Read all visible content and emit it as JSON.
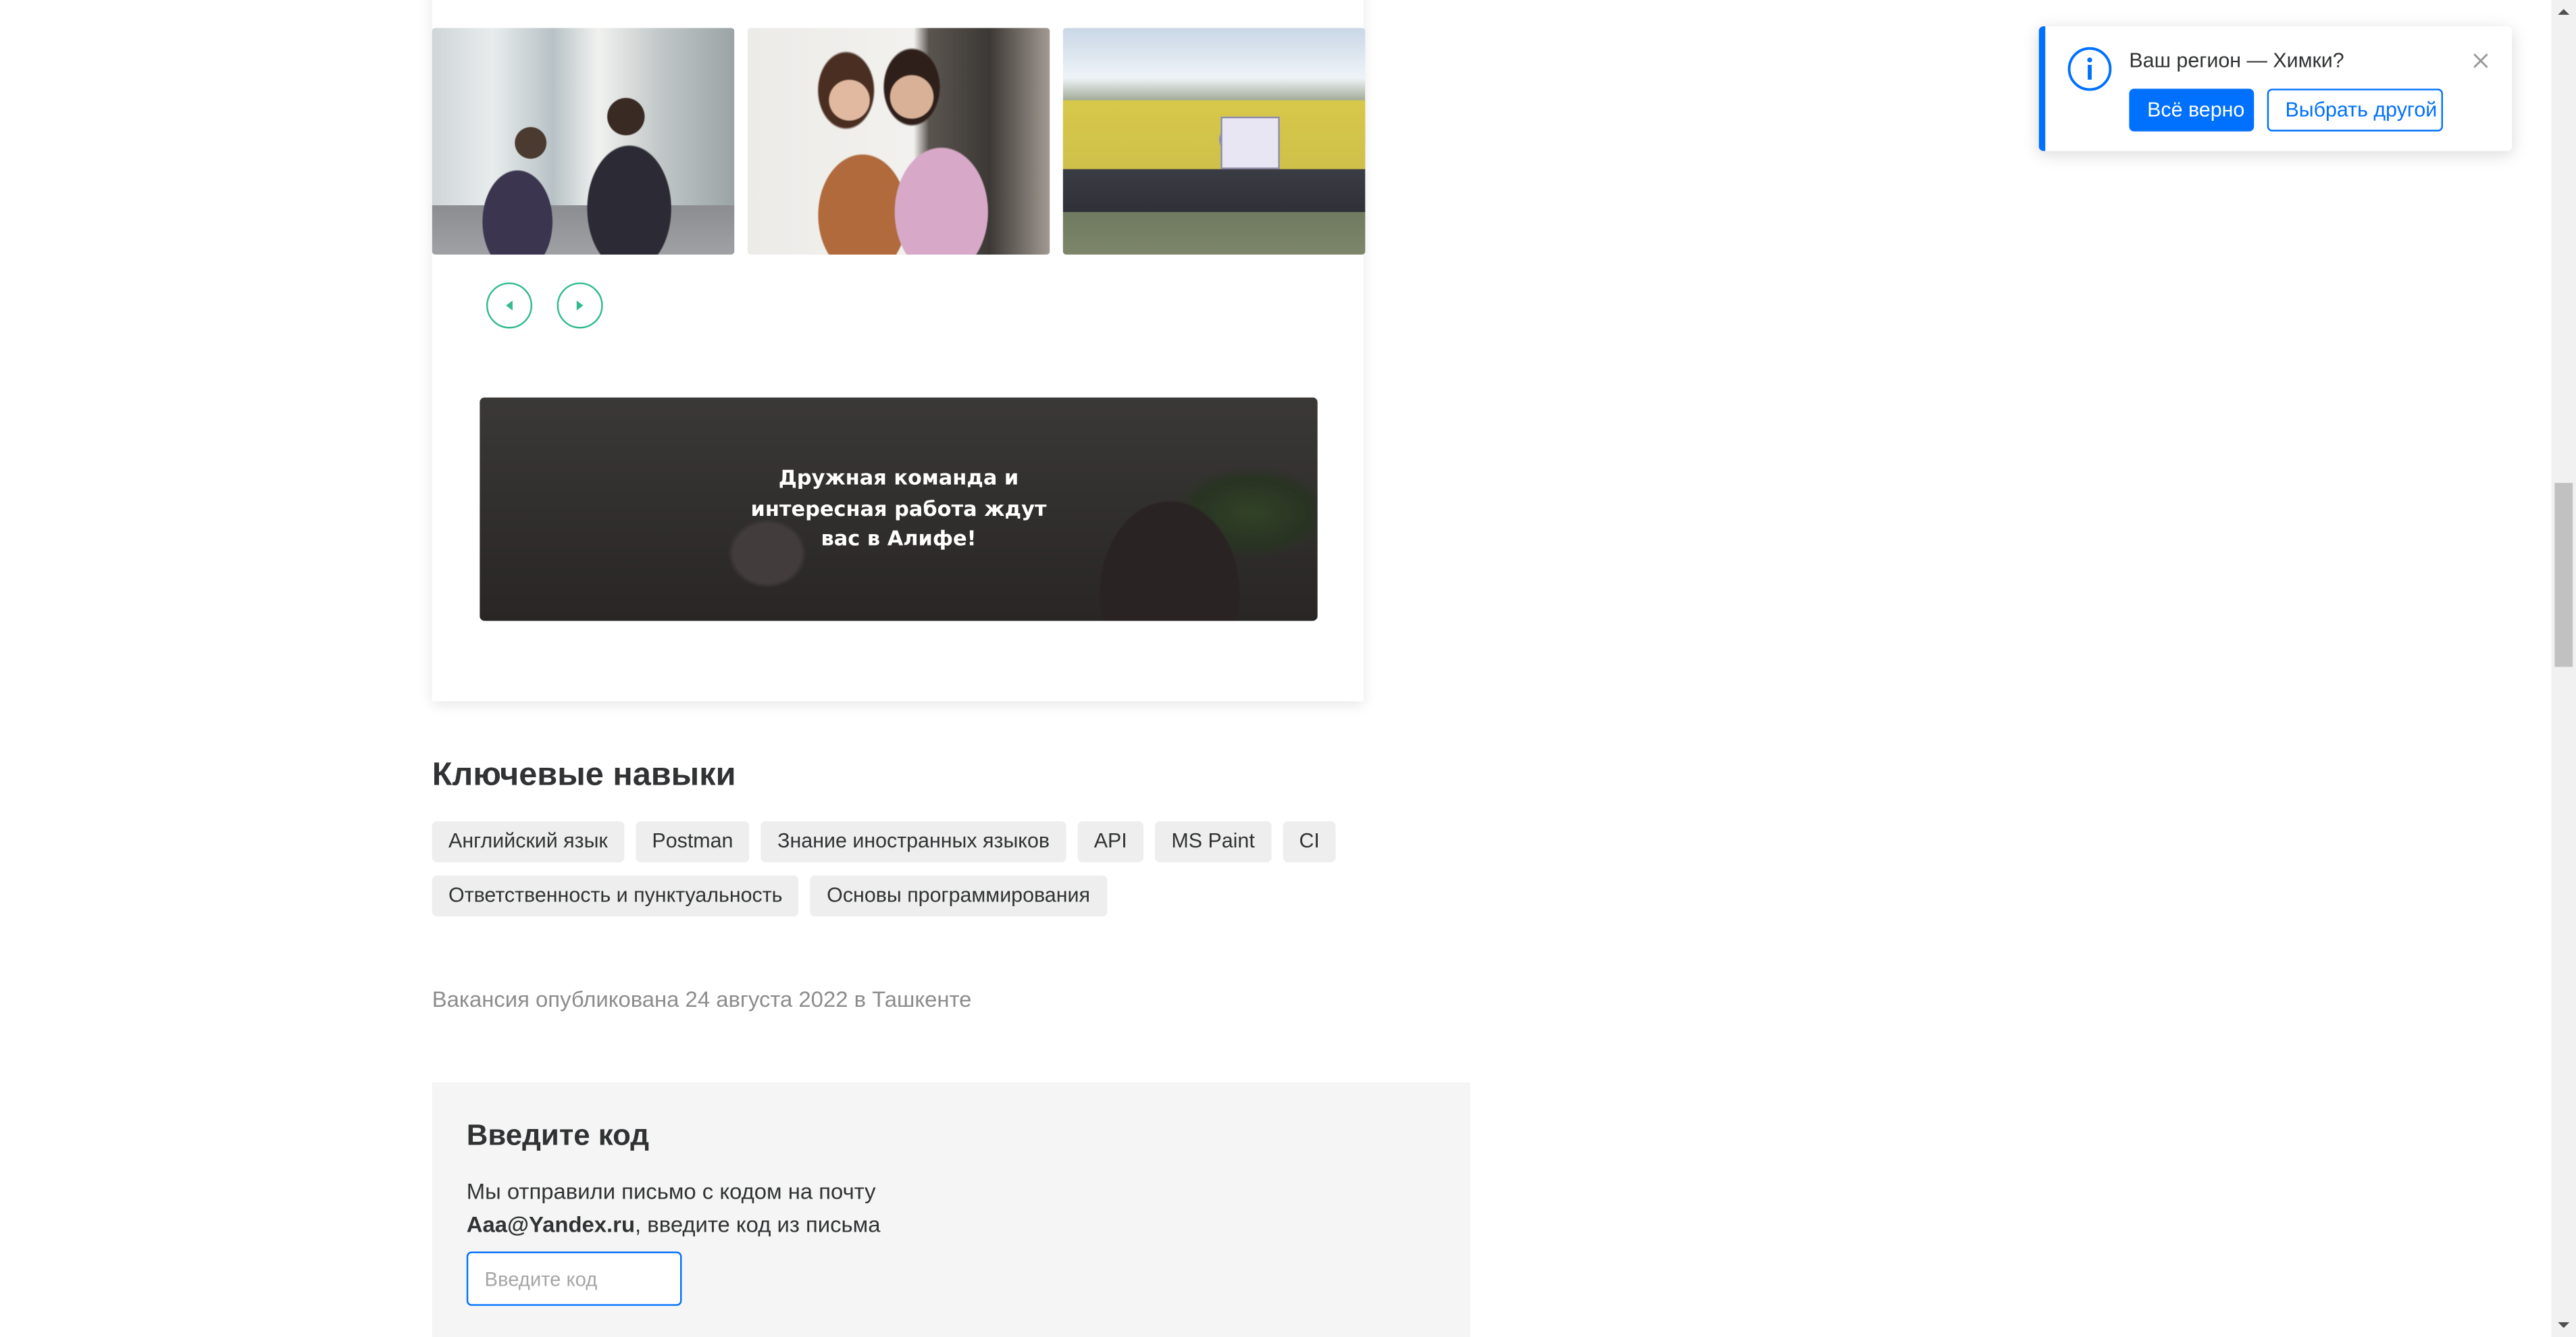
{
  "gallery": {
    "photos": [
      {
        "alt": "team-at-computers"
      },
      {
        "alt": "two-colleagues-hugging"
      },
      {
        "alt": "team-outdoor-group"
      }
    ],
    "accent_color": "#32bb8c"
  },
  "banner": {
    "text": "Дружная команда и интересная работа ждут вас в Алифе!"
  },
  "skills": {
    "title": "Ключевые навыки",
    "row1": [
      "Английский язык",
      "Postman",
      "Знание иностранных языков",
      "API",
      "MS Paint",
      "CI"
    ],
    "row2": [
      "Ответственность и пунктуальность",
      "Основы программирования"
    ]
  },
  "vacancy": {
    "published": "Вакансия опубликована 24 августа 2022 в Ташкенте"
  },
  "code_form": {
    "title": "Введите код",
    "desc_line1": "Мы отправили письмо с кодом на почту",
    "email": "Aaa@Yandex.ru",
    "desc_line2_rest": ", введите код из письма",
    "input_placeholder": "Введите код",
    "input_value": ""
  },
  "region_popup": {
    "question": "Ваш регион — Химки?",
    "confirm_label": "Всё верно",
    "choose_label": "Выбрать другой",
    "accent_color": "#0070ff"
  }
}
